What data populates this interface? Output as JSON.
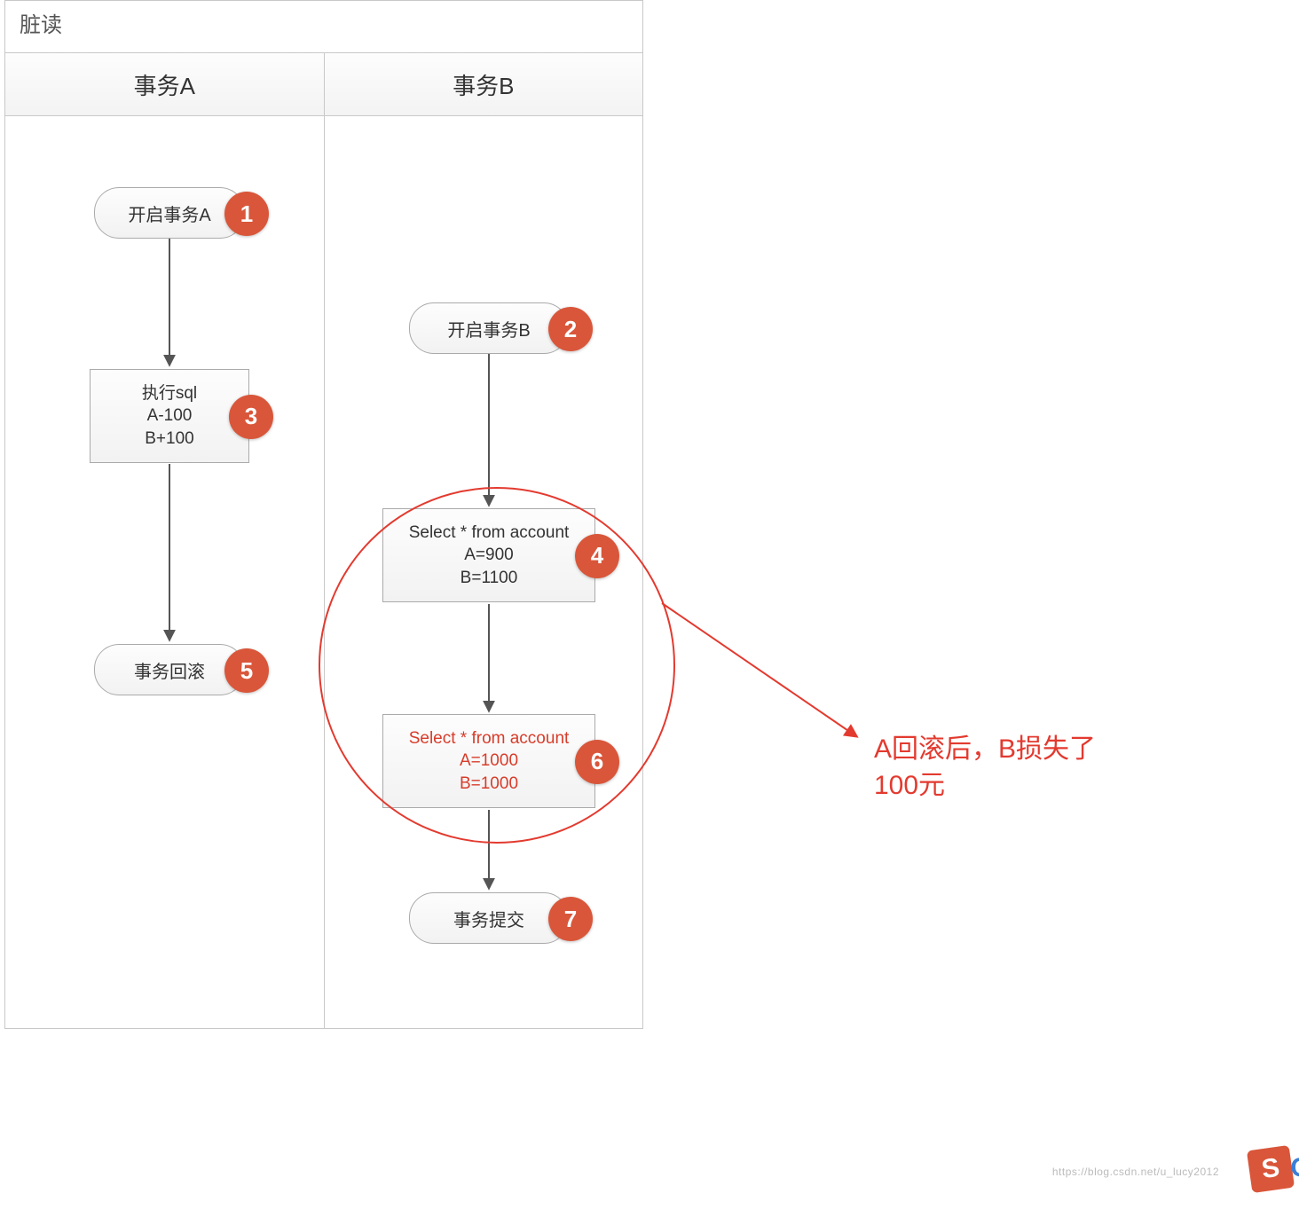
{
  "title": "脏读",
  "columns": {
    "a": "事务A",
    "b": "事务B"
  },
  "nodes": {
    "a_start": {
      "text": "开启事务A",
      "badge": "1"
    },
    "b_start": {
      "text": "开启事务B",
      "badge": "2"
    },
    "a_sql": {
      "l1": "执行sql",
      "l2": "A-100",
      "l3": "B+100",
      "badge": "3"
    },
    "b_sel1": {
      "l1": "Select * from account",
      "l2": "A=900",
      "l3": "B=1100",
      "badge": "4"
    },
    "a_rollback": {
      "text": "事务回滚",
      "badge": "5"
    },
    "b_sel2": {
      "l1": "Select * from account",
      "l2": "A=1000",
      "l3": "B=1000",
      "badge": "6"
    },
    "b_commit": {
      "text": "事务提交",
      "badge": "7"
    }
  },
  "annotation": {
    "l1": "A回滚后，B损失了",
    "l2": "100元"
  },
  "watermark": "https://blog.csdn.net/u_lucy2012",
  "logo": {
    "s": "S",
    "c": "C"
  }
}
